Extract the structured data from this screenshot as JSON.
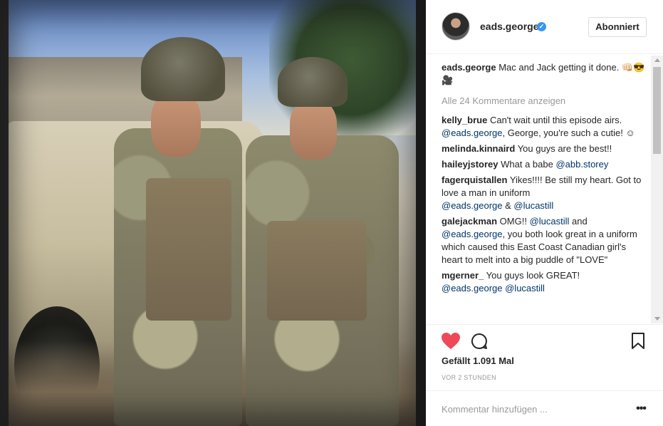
{
  "photo": {
    "description_icon": "photo-post-image"
  },
  "header": {
    "username": "eads.george",
    "verified_icon": "verified-badge-icon",
    "follow_label": "Abonniert"
  },
  "caption": {
    "user": "eads.george",
    "text": "Mac and Jack getting it done. 👊🏻😎🎥"
  },
  "view_all_label": "Alle 24 Kommentare anzeigen",
  "comments": [
    {
      "user": "kelly_brue",
      "text": "Can't wait until this episode airs.",
      "mention1": "@eads.george",
      "text2": ", George, you're such a cutie! ☺"
    },
    {
      "user": "melinda.kinnaird",
      "text": "You guys are the best!!"
    },
    {
      "user": "haileyjstorey",
      "text": "What a babe",
      "mention1": "@abb.storey"
    },
    {
      "user": "fagerquistallen",
      "text": "Yikes!!!! Be still my heart. Got to love a man in uniform",
      "mention1": "@eads.george",
      "text2": " & ",
      "mention2": "@lucastill"
    },
    {
      "user": "galejackman",
      "text": "OMG!!",
      "mention1": "@lucastill",
      "text2": " and ",
      "mention2": "@eads.george",
      "text3": ", you both look great in a uniform which caused this East Coast Canadian girl's heart to melt into a big puddle of \"LOVE\""
    },
    {
      "user": "mgerner_",
      "text": "You guys look GREAT!",
      "mention1": "@eads.george",
      "mention2": "@lucastill"
    }
  ],
  "actions": {
    "like_icon": "heart-icon",
    "comment_icon": "speech-bubble-icon",
    "save_icon": "bookmark-icon",
    "like_color": "#ed4956"
  },
  "likes_label": "Gefällt 1.091 Mal",
  "time_label": "VOR 2 STUNDEN",
  "add_comment": {
    "placeholder": "Kommentar hinzufügen ..."
  },
  "more_label": "•••"
}
